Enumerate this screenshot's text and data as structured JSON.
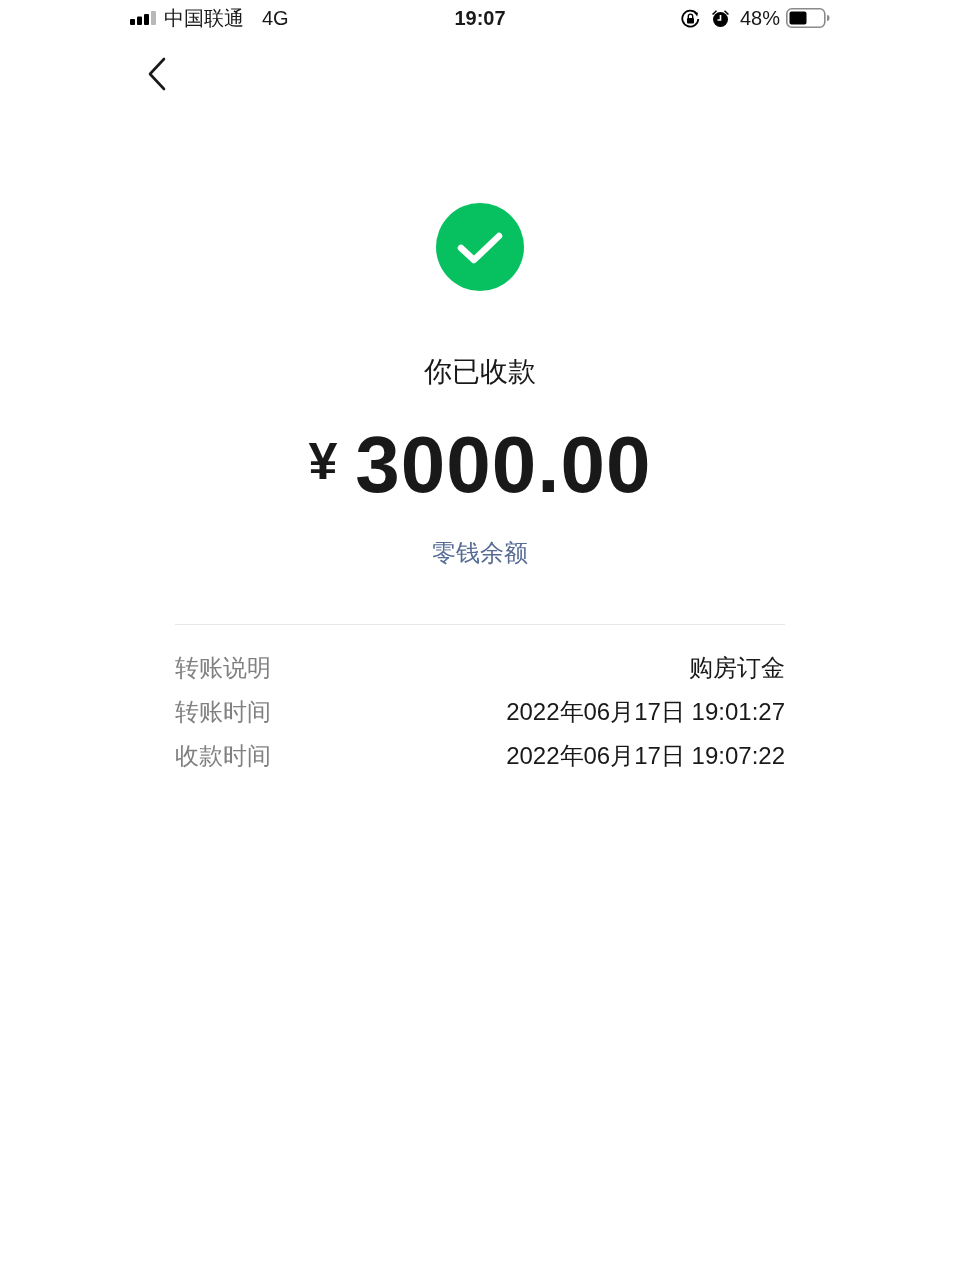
{
  "status_bar": {
    "carrier": "中国联通",
    "network": "4G",
    "time": "19:07",
    "battery": "48%"
  },
  "result": {
    "title": "你已收款",
    "currency": "¥",
    "amount": "3000.00",
    "link": "零钱余额"
  },
  "details": [
    {
      "label": "转账说明",
      "value": "购房订金"
    },
    {
      "label": "转账时间",
      "value": "2022年06月17日 19:01:27"
    },
    {
      "label": "收款时间",
      "value": "2022年06月17日 19:07:22"
    }
  ]
}
